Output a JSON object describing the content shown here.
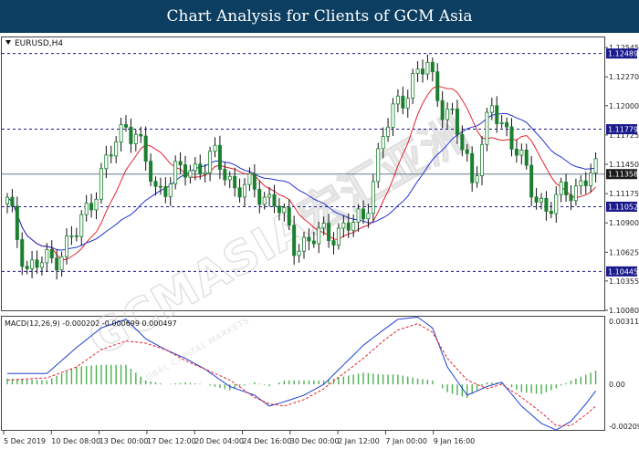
{
  "banner": {
    "title": "Chart Analysis for Clients of GCM Asia"
  },
  "watermark": {
    "text": "GCMASIA宏汇亚洲",
    "subtext": "GLOBAL CAPITAL MARKETS"
  },
  "colors": {
    "banner_bg": "#0c3e61",
    "candle": "#1a7f2e",
    "ma_fast": "#e0242d",
    "ma_slow": "#2233cc",
    "level_line": "#1a1a8c",
    "level_label_bg": "#1a1a8c",
    "current_price_bg": "#1a1a1a",
    "macd_hist": "#4caf50",
    "macd_line": "#1f3fd0",
    "macd_signal": "#e0242d"
  },
  "chart_data": [
    {
      "type": "candlestick",
      "title": "EURUSD,H4",
      "ylim": [
        1.1008,
        1.1264
      ],
      "price_ticks": [
        "1.12545",
        "1.12270",
        "1.12000",
        "1.11725",
        "1.11450",
        "1.11175",
        "1.10900",
        "1.10625",
        "1.10355",
        "1.10080"
      ],
      "levels": [
        "1.12489",
        "1.11779",
        "1.11052",
        "1.10445"
      ],
      "current_price": "1.11358",
      "x_labels": [
        "5 Dec 2019",
        "10 Dec 08:00",
        "13 Dec 00:00",
        "17 Dec 12:00",
        "20 Dec 04:00",
        "24 Dec 16:00",
        "30 Dec 00:00",
        "2 Jan 12:00",
        "7 Jan 00:00",
        "9 Jan 16:00"
      ],
      "close_path": [
        [
          0,
          1.1108
        ],
        [
          4,
          1.1048
        ],
        [
          9,
          1.1055
        ],
        [
          14,
          1.108
        ],
        [
          19,
          1.1135
        ],
        [
          24,
          1.1185
        ],
        [
          26,
          1.1172
        ],
        [
          30,
          1.112
        ],
        [
          34,
          1.1135
        ],
        [
          38,
          1.1142
        ],
        [
          42,
          1.115
        ],
        [
          46,
          1.1125
        ],
        [
          50,
          1.112
        ],
        [
          54,
          1.1112
        ],
        [
          58,
          1.107
        ],
        [
          62,
          1.1075
        ],
        [
          66,
          1.1082
        ],
        [
          70,
          1.1088
        ],
        [
          72,
          1.1095
        ],
        [
          76,
          1.117
        ],
        [
          79,
          1.1205
        ],
        [
          82,
          1.1222
        ],
        [
          85,
          1.1238
        ],
        [
          88,
          1.12
        ],
        [
          90,
          1.1185
        ],
        [
          93,
          1.115
        ],
        [
          94,
          1.113
        ],
        [
          96,
          1.1165
        ],
        [
          98,
          1.1195
        ],
        [
          101,
          1.1178
        ],
        [
          103,
          1.116
        ],
        [
          106,
          1.112
        ],
        [
          109,
          1.1105
        ],
        [
          111,
          1.111
        ],
        [
          113,
          1.1118
        ],
        [
          116,
          1.1128
        ],
        [
          118,
          1.1136
        ],
        [
          119,
          1.1136
        ]
      ]
    },
    {
      "type": "line",
      "title": "MACD(12,26,9) -0.000202 -0.000699 0.000497",
      "ylim": [
        -0.002097,
        0.003119
      ],
      "y_ticks": [
        "0.003119",
        "0.00",
        "-0.002097"
      ],
      "series": [
        {
          "role": "macd",
          "points": [
            [
              0,
              0.0005
            ],
            [
              8,
              0.0005
            ],
            [
              14,
              0.0017
            ],
            [
              19,
              0.0026
            ],
            [
              24,
              0.003
            ],
            [
              28,
              0.0021
            ],
            [
              32,
              0.0016
            ],
            [
              36,
              0.0012
            ],
            [
              40,
              0.0007
            ],
            [
              45,
              -0.0001
            ],
            [
              50,
              -0.0005
            ],
            [
              53,
              -0.001
            ],
            [
              56,
              -0.0008
            ],
            [
              60,
              -0.0005
            ],
            [
              64,
              0.0
            ],
            [
              68,
              0.0009
            ],
            [
              72,
              0.0018
            ],
            [
              76,
              0.0025
            ],
            [
              79,
              0.003
            ],
            [
              83,
              0.0031
            ],
            [
              86,
              0.0026
            ],
            [
              89,
              0.0008
            ],
            [
              93,
              -0.0005
            ],
            [
              97,
              -0.0001
            ],
            [
              100,
              0.0001
            ],
            [
              104,
              -0.001
            ],
            [
              108,
              -0.0018
            ],
            [
              111,
              -0.0021
            ],
            [
              114,
              -0.0017
            ],
            [
              117,
              -0.0009
            ],
            [
              119,
              -0.0003
            ]
          ]
        },
        {
          "role": "signal",
          "points": [
            [
              0,
              0.0002
            ],
            [
              8,
              0.0003
            ],
            [
              14,
              0.0008
            ],
            [
              19,
              0.0016
            ],
            [
              24,
              0.002
            ],
            [
              28,
              0.0019
            ],
            [
              32,
              0.0016
            ],
            [
              36,
              0.0011
            ],
            [
              40,
              0.0007
            ],
            [
              45,
              0.0002
            ],
            [
              50,
              -0.0006
            ],
            [
              53,
              -0.0009
            ],
            [
              56,
              -0.001
            ],
            [
              60,
              -0.0007
            ],
            [
              64,
              -0.0002
            ],
            [
              68,
              0.0005
            ],
            [
              72,
              0.0012
            ],
            [
              76,
              0.002
            ],
            [
              79,
              0.0025
            ],
            [
              83,
              0.0028
            ],
            [
              86,
              0.0024
            ],
            [
              89,
              0.0012
            ],
            [
              93,
              0.0002
            ],
            [
              97,
              -0.0002
            ],
            [
              100,
              0.0
            ],
            [
              104,
              -0.0006
            ],
            [
              108,
              -0.0013
            ],
            [
              111,
              -0.0019
            ],
            [
              114,
              -0.0019
            ],
            [
              117,
              -0.0014
            ],
            [
              119,
              -0.001
            ]
          ]
        }
      ]
    }
  ]
}
